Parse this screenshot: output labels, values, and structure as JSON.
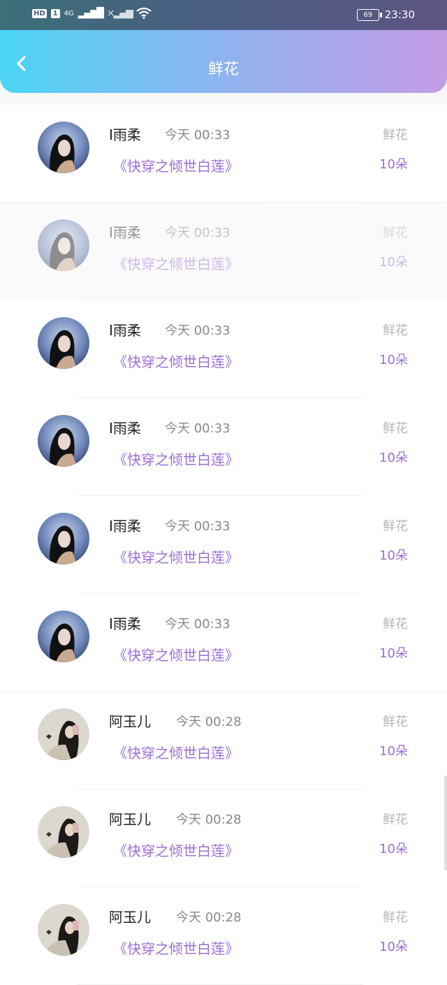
{
  "status_bar": {
    "hd": "HD",
    "sim": "1",
    "net": "4G",
    "signal": "▂▄▆█",
    "signal2": "×▂▄▆",
    "wifi": "wifi-icon",
    "battery": "69",
    "time": "23:30"
  },
  "header": {
    "title": "鲜花"
  },
  "rows": [
    {
      "name": "I雨柔",
      "time": "今天 00:33",
      "book": "《快穿之倾世白莲》",
      "type": "鲜花",
      "count": "10朵",
      "avatar": "girl-dark"
    },
    {
      "name": "I雨柔",
      "time": "今天 00:33",
      "book": "《快穿之倾世白莲》",
      "type": "鲜花",
      "count": "10朵",
      "avatar": "girl-dark"
    },
    {
      "name": "I雨柔",
      "time": "今天 00:33",
      "book": "《快穿之倾世白莲》",
      "type": "鲜花",
      "count": "10朵",
      "avatar": "girl-dark"
    },
    {
      "name": "I雨柔",
      "time": "今天 00:33",
      "book": "《快穿之倾世白莲》",
      "type": "鲜花",
      "count": "10朵",
      "avatar": "girl-dark"
    },
    {
      "name": "I雨柔",
      "time": "今天 00:33",
      "book": "《快穿之倾世白莲》",
      "type": "鲜花",
      "count": "10朵",
      "avatar": "girl-dark"
    },
    {
      "name": "I雨柔",
      "time": "今天 00:33",
      "book": "《快穿之倾世白莲》",
      "type": "鲜花",
      "count": "10朵",
      "avatar": "girl-dark"
    },
    {
      "name": "阿玉儿",
      "time": "今天 00:28",
      "book": "《快穿之倾世白莲》",
      "type": "鲜花",
      "count": "10朵",
      "avatar": "girl-light"
    },
    {
      "name": "阿玉儿",
      "time": "今天 00:28",
      "book": "《快穿之倾世白莲》",
      "type": "鲜花",
      "count": "10朵",
      "avatar": "girl-light"
    },
    {
      "name": "阿玉儿",
      "time": "今天 00:28",
      "book": "《快穿之倾世白莲》",
      "type": "鲜花",
      "count": "10朵",
      "avatar": "girl-light"
    }
  ]
}
